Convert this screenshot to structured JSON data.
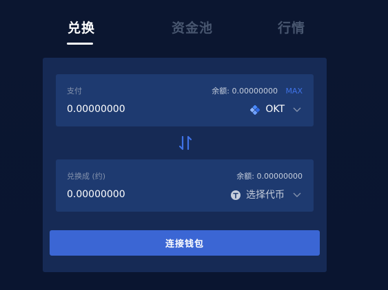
{
  "tabs": [
    {
      "label": "兑换",
      "active": true
    },
    {
      "label": "资金池",
      "active": false
    },
    {
      "label": "行情",
      "active": false
    }
  ],
  "pay": {
    "label": "支付",
    "balance_label": "余额:",
    "balance_value": "0.00000000",
    "max_label": "MAX",
    "amount": "0.00000000",
    "token": "OKT",
    "token_icon": "okt-token-icon"
  },
  "swap": {
    "icon": "swap-direction-icon"
  },
  "receive": {
    "label": "兑换成 (约)",
    "balance_label": "余额:",
    "balance_value": "0.00000000",
    "amount": "0.00000000",
    "token": "选择代币",
    "token_icon": "token-placeholder-icon"
  },
  "connect": {
    "label": "连接钱包"
  },
  "colors": {
    "background": "#0b1630",
    "panel": "#162a55",
    "card": "#1e3a70",
    "accent": "#3b66d4",
    "max_link": "#3f72e6",
    "inactive_tab": "#48566f"
  }
}
